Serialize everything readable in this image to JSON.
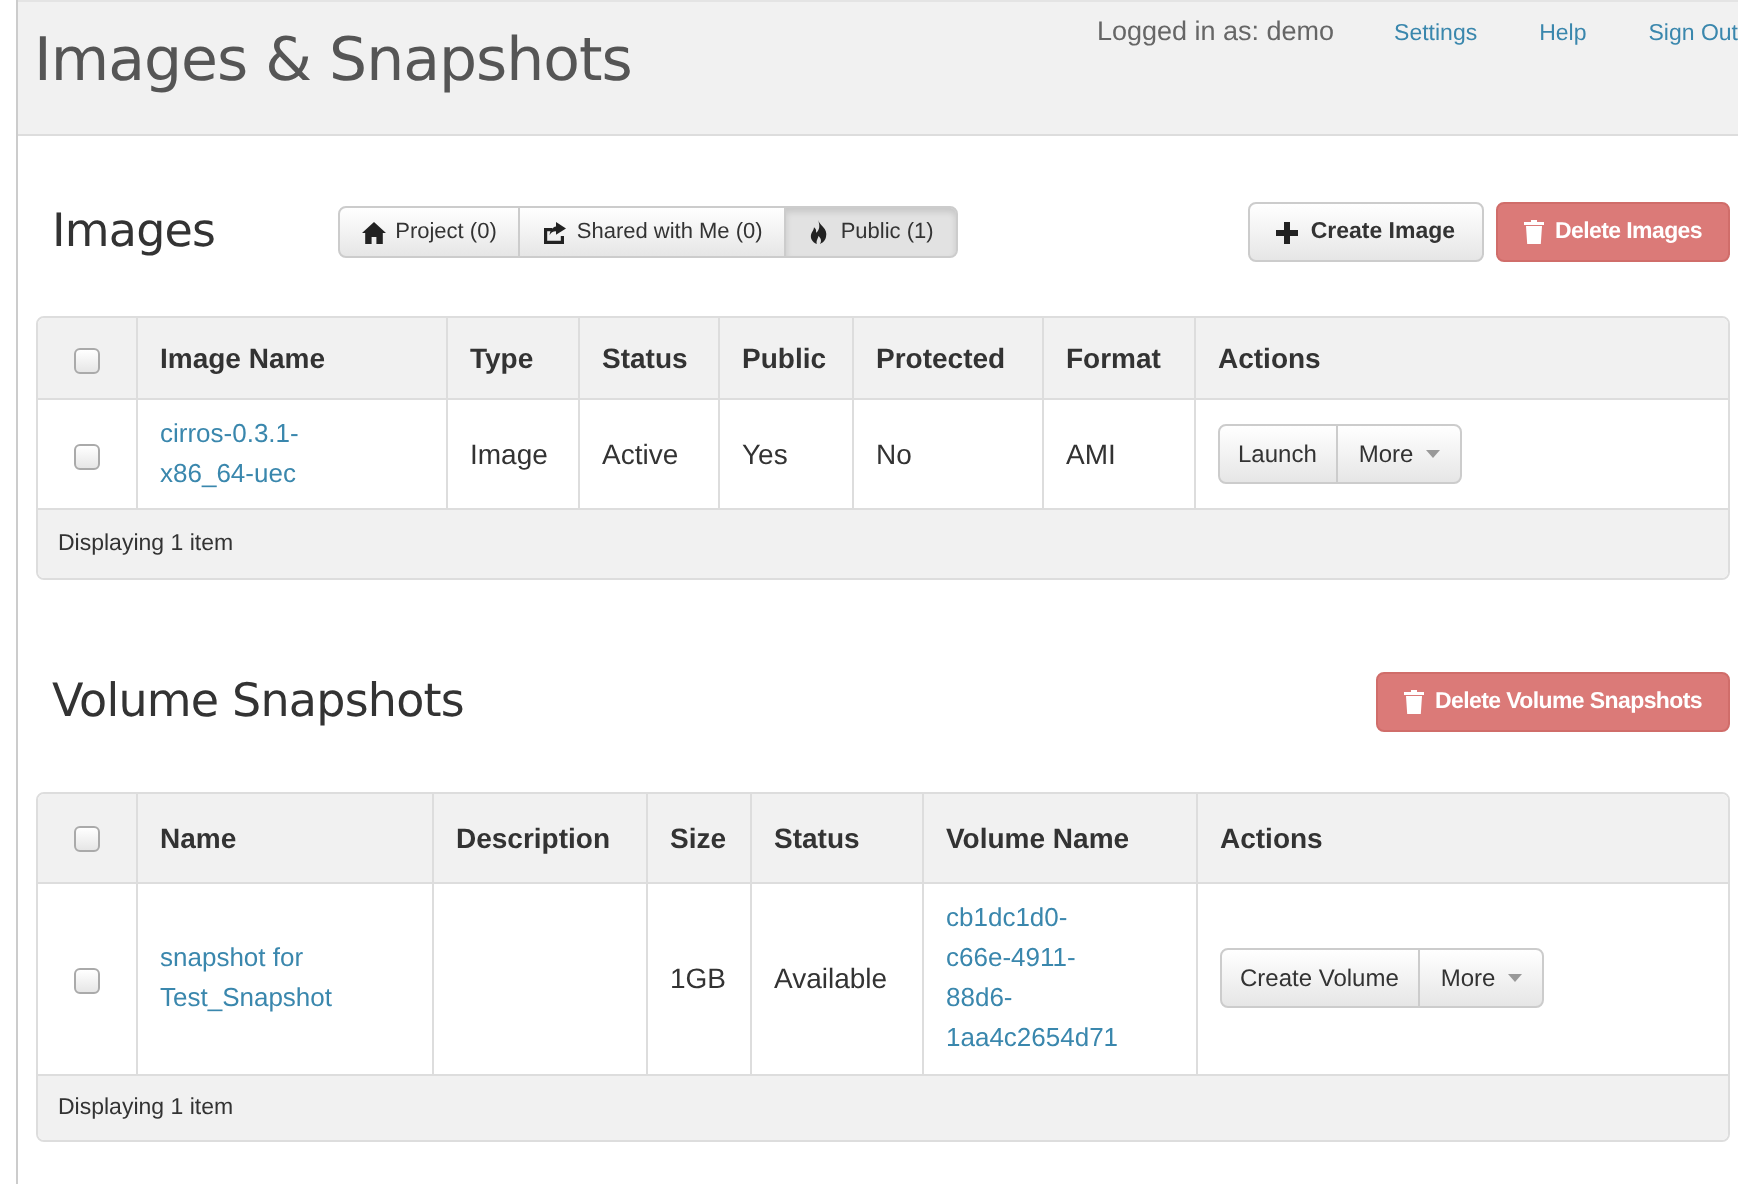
{
  "header": {
    "title": "Images & Snapshots",
    "user_text": "Logged in as: demo",
    "links": [
      "Settings",
      "Help",
      "Sign Out"
    ]
  },
  "sections": [
    {
      "title": "Images",
      "filters": [
        {
          "label": "Project (0)",
          "selected": false
        },
        {
          "label": "Shared with Me (0)",
          "selected": false
        },
        {
          "label": "Public (1)",
          "selected": true
        }
      ],
      "actions": [
        {
          "label": "Create Image",
          "kind": "default"
        },
        {
          "label": "Delete Images",
          "kind": "danger"
        }
      ],
      "table": {
        "select_all_checked": false,
        "columns": [
          "Image Name",
          "Type",
          "Status",
          "Public",
          "Protected",
          "Format",
          "Actions"
        ],
        "rows": [
          {
            "checked": false,
            "cells": [
              {
                "kind": "link",
                "text": "cirros-0.3.1-x86_64-uec"
              },
              {
                "kind": "text",
                "text": "Image"
              },
              {
                "kind": "text",
                "text": "Active"
              },
              {
                "kind": "text",
                "text": "Yes"
              },
              {
                "kind": "text",
                "text": "No"
              },
              {
                "kind": "text",
                "text": "AMI"
              },
              {
                "kind": "actions",
                "buttons": [
                  "Launch",
                  "More"
                ]
              }
            ]
          }
        ],
        "footer": "Displaying 1 item"
      }
    },
    {
      "title": "Volume Snapshots",
      "actions": [
        {
          "label": "Delete Volume Snapshots",
          "kind": "danger"
        }
      ],
      "table": {
        "select_all_checked": false,
        "columns": [
          "Name",
          "Description",
          "Size",
          "Status",
          "Volume Name",
          "Actions"
        ],
        "rows": [
          {
            "checked": false,
            "cells": [
              {
                "kind": "link",
                "text": "snapshot for Test_Snapshot"
              },
              {
                "kind": "empty"
              },
              {
                "kind": "text",
                "text": "1GB"
              },
              {
                "kind": "text",
                "text": "Available"
              },
              {
                "kind": "link",
                "text": "cb1dc1d0-c66e-4911-88d6-1aa4c2654d71"
              },
              {
                "kind": "actions",
                "buttons": [
                  "Create Volume",
                  "More"
                ]
              }
            ]
          }
        ],
        "footer": "Displaying 1 item"
      }
    }
  ]
}
